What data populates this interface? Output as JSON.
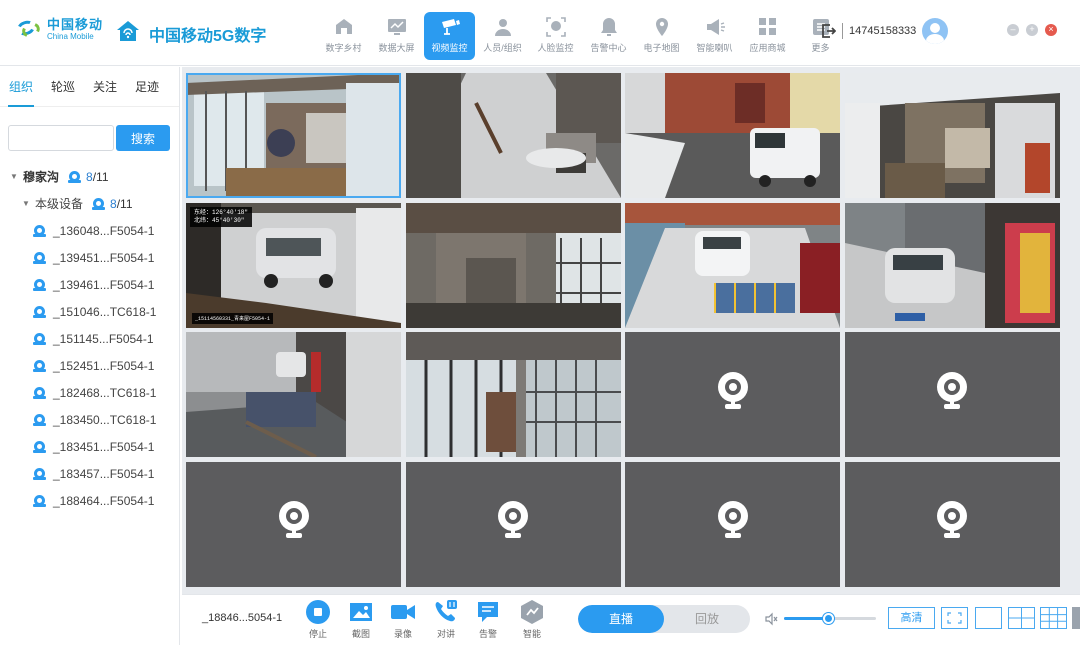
{
  "header": {
    "logo_cn": "中国移动",
    "logo_en": "China Mobile",
    "app_title": "中国移动5G数字",
    "phone": "14745158333",
    "nav": [
      {
        "label": "数字乡村",
        "icon": "village-icon",
        "active": false
      },
      {
        "label": "数据大屏",
        "icon": "monitor-screen-icon",
        "active": false
      },
      {
        "label": "视频监控",
        "icon": "surveillance-camera-icon",
        "active": true
      },
      {
        "label": "人员/组织",
        "icon": "people-icon",
        "active": false
      },
      {
        "label": "人脸监控",
        "icon": "face-scan-icon",
        "active": false
      },
      {
        "label": "告警中心",
        "icon": "alarm-bell-icon",
        "active": false
      },
      {
        "label": "电子地图",
        "icon": "map-pin-icon",
        "active": false
      },
      {
        "label": "智能喇叭",
        "icon": "speaker-icon",
        "active": false
      },
      {
        "label": "应用商城",
        "icon": "app-grid-icon",
        "active": false
      },
      {
        "label": "更多",
        "icon": "more-icon",
        "active": false
      }
    ]
  },
  "sidebar": {
    "tabs": [
      "组织",
      "轮巡",
      "关注",
      "足迹"
    ],
    "active_tab": 0,
    "search": {
      "placeholder": "",
      "button": "搜索"
    },
    "root": {
      "name": "穆家沟",
      "online": "8",
      "total": "/11"
    },
    "group": {
      "name": "本级设备",
      "online": "8",
      "total": "/11"
    },
    "devices": [
      "_136048...F5054-1",
      "_139451...F5054-1",
      "_139461...F5054-1",
      "_151046...TC618-1",
      "_151145...F5054-1",
      "_152451...F5054-1",
      "_182468...TC618-1",
      "_183450...TC618-1",
      "_183451...F5054-1",
      "_183457...F5054-1",
      "_188464...F5054-1"
    ]
  },
  "video": {
    "selected_tile": 0,
    "overlay_coord": [
      "东经：126°40'18\"",
      "北纬：45°40'30\""
    ],
    "overlay_label": "_15114560331_青来屋F5054-1",
    "tiles": [
      {
        "live": true,
        "scene": "balcony"
      },
      {
        "live": true,
        "scene": "snowyard"
      },
      {
        "live": true,
        "scene": "van"
      },
      {
        "live": true,
        "scene": "shed"
      },
      {
        "live": true,
        "scene": "car"
      },
      {
        "live": true,
        "scene": "corridor"
      },
      {
        "live": true,
        "scene": "parking"
      },
      {
        "live": true,
        "scene": "alley"
      },
      {
        "live": true,
        "scene": "street"
      },
      {
        "live": true,
        "scene": "porch"
      },
      {
        "live": false
      },
      {
        "live": false
      },
      {
        "live": false
      },
      {
        "live": false
      },
      {
        "live": false
      },
      {
        "live": false
      }
    ]
  },
  "controls": {
    "current_device": "_18846...5054-1",
    "buttons": [
      {
        "label": "停止",
        "icon": "stop-icon"
      },
      {
        "label": "截图",
        "icon": "screenshot-icon"
      },
      {
        "label": "录像",
        "icon": "record-icon"
      },
      {
        "label": "对讲",
        "icon": "intercom-icon"
      },
      {
        "label": "告警",
        "icon": "alarm-icon"
      },
      {
        "label": "智能",
        "icon": "smart-icon"
      }
    ],
    "mode_live": "直播",
    "mode_playback": "回放",
    "volume": 0.48,
    "quality": "高清"
  },
  "colors": {
    "accent": "#2b9bf0",
    "brand": "#1a9bd7",
    "empty_tile": "#5c5c5e"
  }
}
